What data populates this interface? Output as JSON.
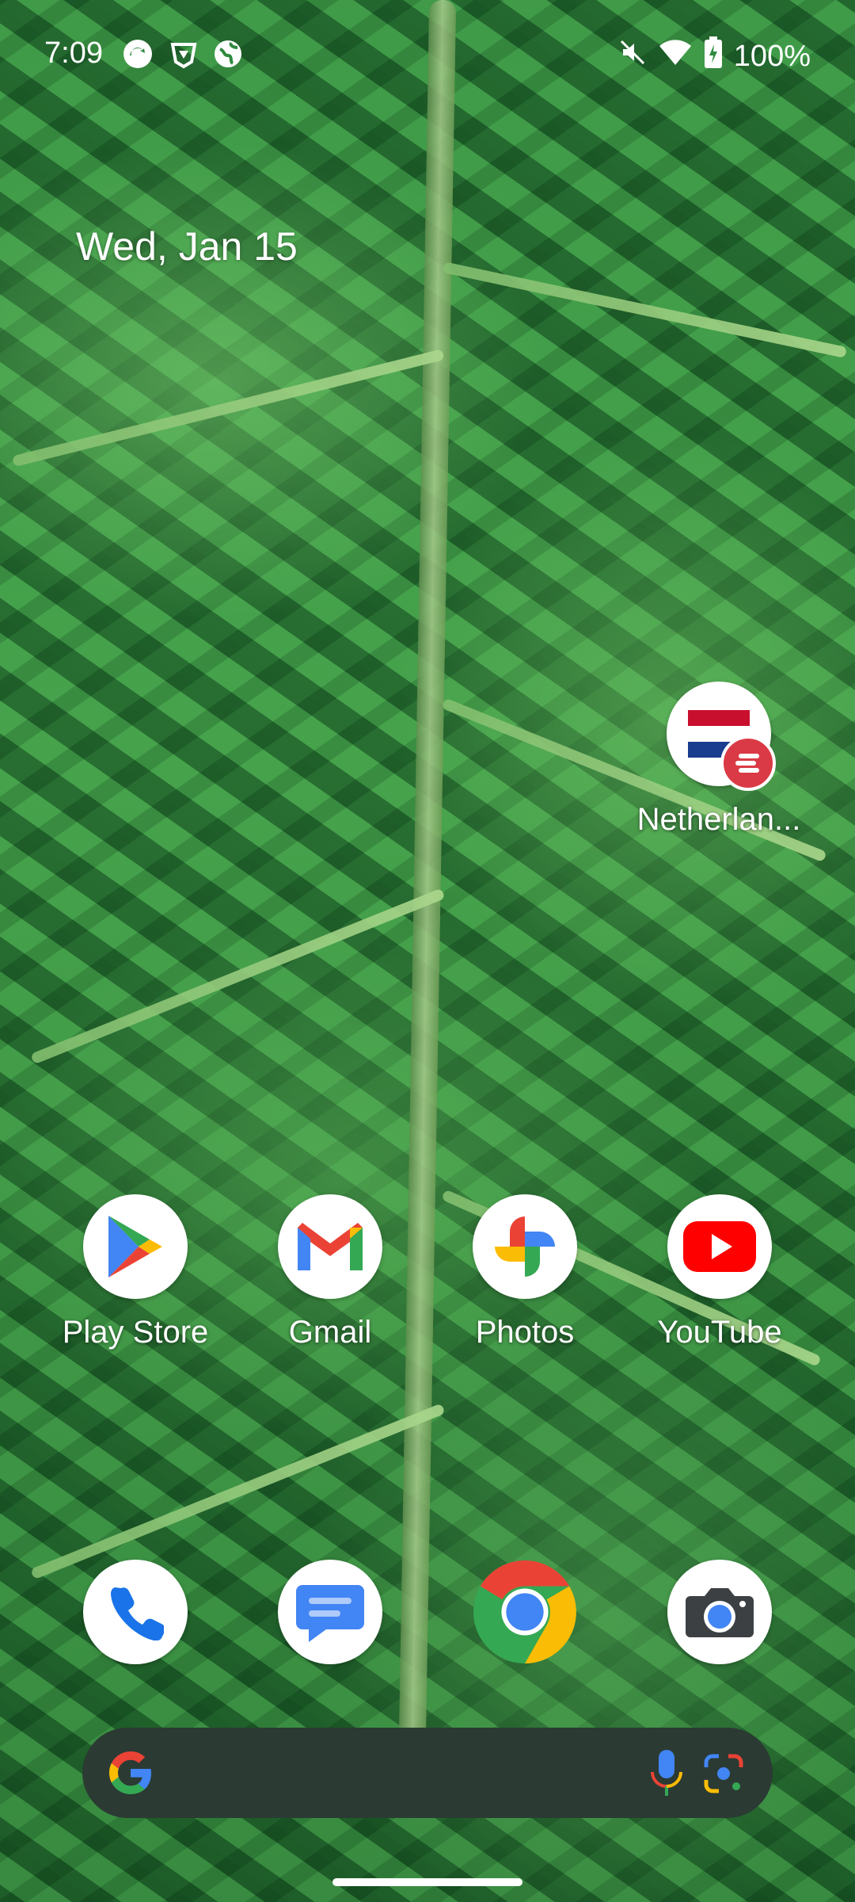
{
  "status_bar": {
    "time": "7:09",
    "notification_icons": [
      "sync-icon",
      "vpn-shield-icon",
      "globe-icon"
    ],
    "right_icons": [
      "mute-icon",
      "wifi-icon",
      "battery-charging-icon"
    ],
    "battery": "100%"
  },
  "date_widget": {
    "text": "Wed, Jan 15"
  },
  "shortcut": {
    "label": "Netherlan..."
  },
  "apps_row": [
    {
      "label": "Play Store",
      "icon": "play-store-icon"
    },
    {
      "label": "Gmail",
      "icon": "gmail-icon"
    },
    {
      "label": "Photos",
      "icon": "photos-icon"
    },
    {
      "label": "YouTube",
      "icon": "youtube-icon"
    }
  ],
  "dock": [
    {
      "icon": "phone-icon"
    },
    {
      "icon": "messages-icon"
    },
    {
      "icon": "chrome-icon"
    },
    {
      "icon": "camera-icon"
    }
  ],
  "search_bar": {
    "icons": [
      "google-g-icon",
      "microphone-icon",
      "lens-icon"
    ]
  },
  "colors": {
    "wallpaper": "#2e8a3e",
    "search_bg": "#2b3a33",
    "google_blue": "#4285F4",
    "google_red": "#EA4335",
    "google_yellow": "#FBBC05",
    "google_green": "#34A853"
  }
}
